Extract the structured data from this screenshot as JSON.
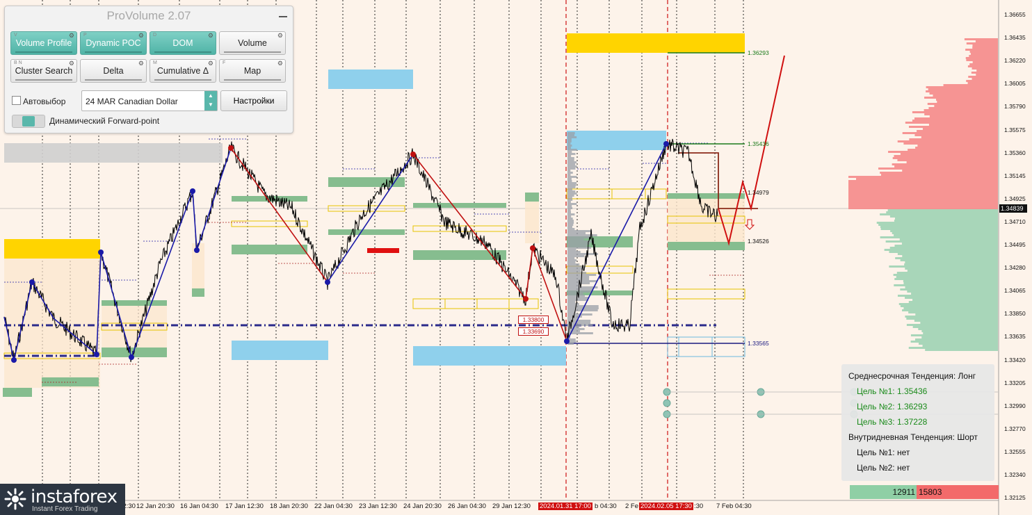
{
  "panel": {
    "title": "ProVolume 2.07",
    "buttons": [
      {
        "key": "V",
        "label": "Volume Profile",
        "active": true
      },
      {
        "key": "P",
        "label": "Dynamic POC",
        "active": true
      },
      {
        "key": "D",
        "label": "DOM",
        "active": true
      },
      {
        "key": "",
        "label": "Volume",
        "active": false
      },
      {
        "key": "B N",
        "label": "Cluster Search",
        "active": false
      },
      {
        "key": "",
        "label": "Delta",
        "active": false
      },
      {
        "key": "M",
        "label": "Cumulative Δ",
        "active": false
      },
      {
        "key": "F",
        "label": "Map",
        "active": false
      }
    ],
    "autoselect_label": "Автовыбор",
    "instrument": "24 MAR Canadian Dollar",
    "settings_label": "Настройки",
    "forward_label": "Динамический Forward-point"
  },
  "price_axis": {
    "ticks": [
      "1.36655",
      "1.36435",
      "1.36220",
      "1.36005",
      "1.35790",
      "1.35575",
      "1.35360",
      "1.35145",
      "1.34925",
      "1.34710",
      "1.34495",
      "1.34280",
      "1.34065",
      "1.33850",
      "1.33635",
      "1.33420",
      "1.33205",
      "1.32990",
      "1.32770",
      "1.32555",
      "1.32340",
      "1.32125"
    ],
    "current_price": "1.34839"
  },
  "date_axis": {
    "labels": [
      "10 Jan 12:30",
      "12 Jan 20:30",
      "16 Jan 04:30",
      "17 Jan 12:30",
      "18 Jan 20:30",
      "22 Jan 04:30",
      "23 Jan 12:30",
      "24 Jan 20:30",
      "26 Jan 04:30",
      "29 Jan 12:30",
      "b 04:30",
      "2 Fe",
      ":30",
      "7 Feb 04:30"
    ],
    "highlight_1": "2024.01.31 17:00",
    "highlight_2": "2024.02.05 17:30"
  },
  "levels": {
    "l1": "1.36293",
    "l2": "1.35436",
    "l3": "1.34979",
    "l4": "1.34526",
    "l5": "1.33565",
    "box1": "1.33800",
    "box2": "1.33690"
  },
  "info": {
    "mid_term": "Среднесрочная Тенденция: Лонг",
    "t1": "Цель №1: 1.35436",
    "t2": "Цель №2: 1.36293",
    "t3": "Цель №3: 1.37228",
    "intraday": "Внутридневная Тенденция: Шорт",
    "i1": "Цель №1: нет",
    "i2": "Цель №2: нет"
  },
  "volume_balance": {
    "buy": "12911",
    "sell": "15803"
  },
  "logo": {
    "name": "instaforex",
    "tagline": "Instant Forex Trading"
  },
  "colors": {
    "bg": "#fdf3ea",
    "accent": "#59b7ab",
    "up_line": "#1a1aa8",
    "down_line": "#cc1111",
    "support": "#2a2a8a",
    "yellow_zone": "#ffd400",
    "blue_zone": "#8fd0ec",
    "green_zone": "#86bd8f",
    "sell_profile": "#f58a8a",
    "buy_profile": "#9fd3b4"
  }
}
